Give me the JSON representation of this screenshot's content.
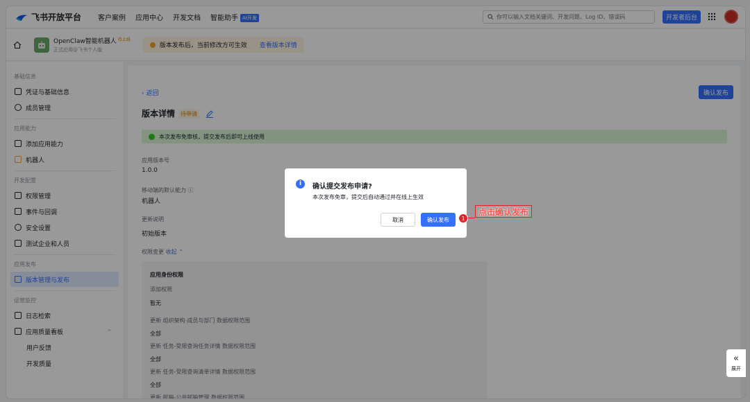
{
  "topnav": {
    "brand": "飞书开放平台",
    "links": [
      "客户案例",
      "应用中心",
      "开发文档",
      "智能助手"
    ],
    "ai_badge": "AI开发",
    "search_placeholder": "你可以输入文档关键词、开发问题、Log ID、错误码",
    "dev_console": "开发者后台"
  },
  "appbar": {
    "app_name": "OpenClaw智能机器人",
    "app_status": "待上线",
    "app_sub": "正式应用@飞书个人版",
    "notice": "版本发布后，当前修改方可生效",
    "notice_link": "查看版本详情"
  },
  "sidebar": {
    "sections": [
      {
        "title": "基础信息",
        "items": [
          "凭证与基础信息",
          "成员管理"
        ]
      },
      {
        "title": "应用能力",
        "items": [
          "添加应用能力",
          "机器人"
        ]
      },
      {
        "title": "开发配置",
        "items": [
          "权限管理",
          "事件与回调",
          "安全设置",
          "测试企业和人员"
        ]
      },
      {
        "title": "应用发布",
        "items": [
          "版本管理与发布"
        ]
      },
      {
        "title": "运营监控",
        "items": [
          "日志检索",
          "应用质量看板"
        ]
      }
    ],
    "sub_items": [
      "用户反馈",
      "开发质量"
    ]
  },
  "main": {
    "back": "返回",
    "confirm_publish": "确认发布",
    "title": "版本详情",
    "pending": "待申请",
    "success_msg": "本次发布免审核，提交发布后即可上线使用",
    "version_label": "应用版本号",
    "version_value": "1.0.0",
    "mobile_label": "移动端的默认能力",
    "mobile_value": "机器人",
    "update_label": "更新说明",
    "update_value": "初始版本",
    "perm_label": "权限变更",
    "perm_collapse": "收起",
    "perm_lines": [
      "应用身份权限",
      "添加权限",
      "暂无",
      "更新 组织架构-成员与部门 数据权限范围",
      "全部",
      "更新 任务-受限查询任务详情 数据权限范围",
      "全部",
      "更新 任务-受限查询清单详情 数据权限范围",
      "全部",
      "更新 邮箱-公共邮箱管理 数据权限范围"
    ]
  },
  "dialog": {
    "title": "确认提交发布申请?",
    "desc": "本次发布免审，提交后自动通过并在线上生效",
    "cancel": "取消",
    "confirm": "确认发布"
  },
  "annotation": {
    "step": "1",
    "text": "点击确认发布"
  },
  "expand": {
    "label": "展开"
  },
  "colors": {
    "primary": "#3370ff",
    "annotation": "#e02424",
    "success_bg": "#d9f5d6"
  }
}
